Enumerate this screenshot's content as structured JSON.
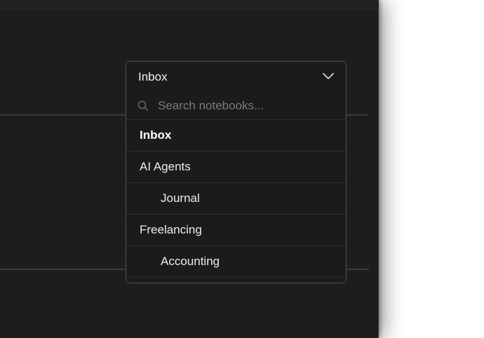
{
  "picker": {
    "selected_label": "Inbox",
    "search_placeholder": "Search notebooks...",
    "search_value": "",
    "items": [
      {
        "label": "Inbox",
        "selected": true,
        "indent": false
      },
      {
        "label": "AI Agents",
        "selected": false,
        "indent": false
      },
      {
        "label": "Journal",
        "selected": false,
        "indent": true
      },
      {
        "label": "Freelancing",
        "selected": false,
        "indent": false
      },
      {
        "label": "Accounting",
        "selected": false,
        "indent": true
      }
    ]
  },
  "icons": {
    "header_chevron": "chevron-down-icon",
    "search": "search-icon"
  },
  "colors": {
    "window_background": "#1d1d1d",
    "picker_border": "#4a5560",
    "text": "#ececec",
    "placeholder": "#7b7b7b"
  }
}
